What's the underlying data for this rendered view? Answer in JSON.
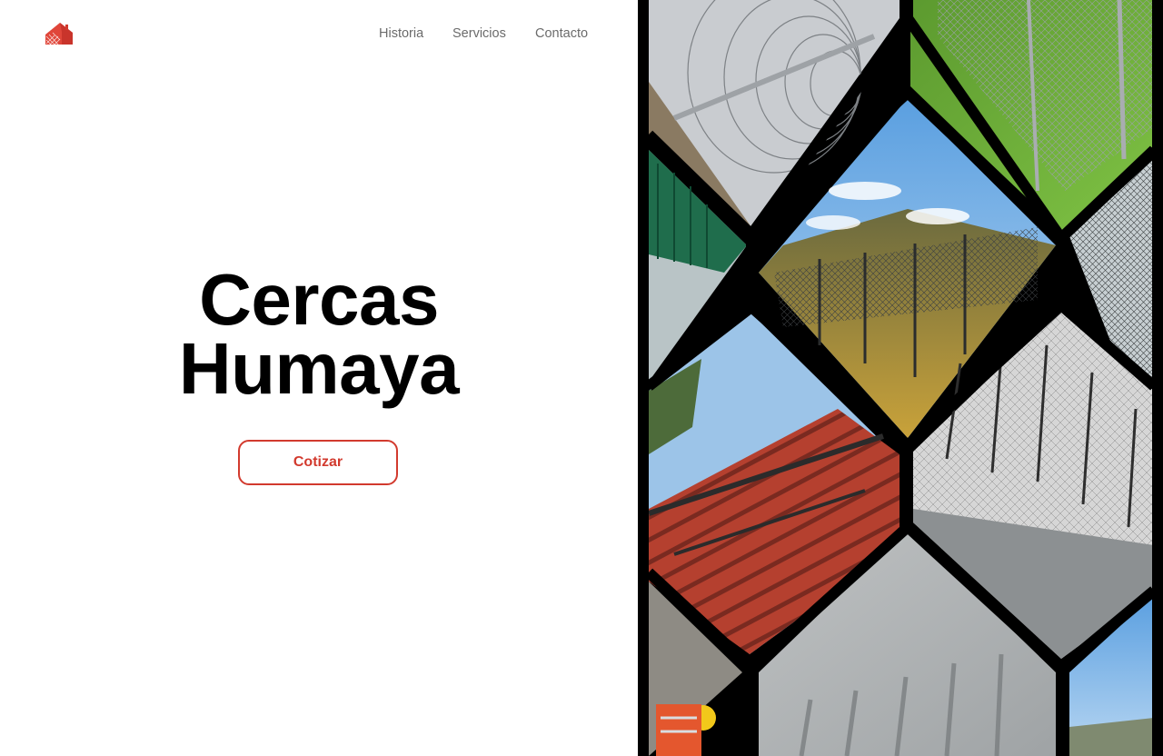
{
  "header": {
    "logo_icon": "house-fence-logo-icon",
    "nav": [
      {
        "label": "Historia"
      },
      {
        "label": "Servicios"
      },
      {
        "label": "Contacto"
      }
    ]
  },
  "hero": {
    "title_line1": "Cercas",
    "title_line2": "Humaya",
    "cta_label": "Cotizar"
  },
  "gallery": {
    "photos": [
      "razor-wire-coil-photo",
      "chain-link-fence-grass-photo",
      "green-privacy-fence-photo",
      "welded-mesh-fence-field-photo",
      "mesh-panel-fence-photo",
      "red-roof-pergola-photo",
      "security-fence-barbed-top-photo",
      "workers-construction-photo",
      "concrete-wall-shadow-photo",
      "fence-perimeter-sky-photo"
    ]
  },
  "colors": {
    "accent": "#d23a2e",
    "text": "#000000",
    "nav_text": "#6b6b6b",
    "gallery_frame": "#000000"
  }
}
